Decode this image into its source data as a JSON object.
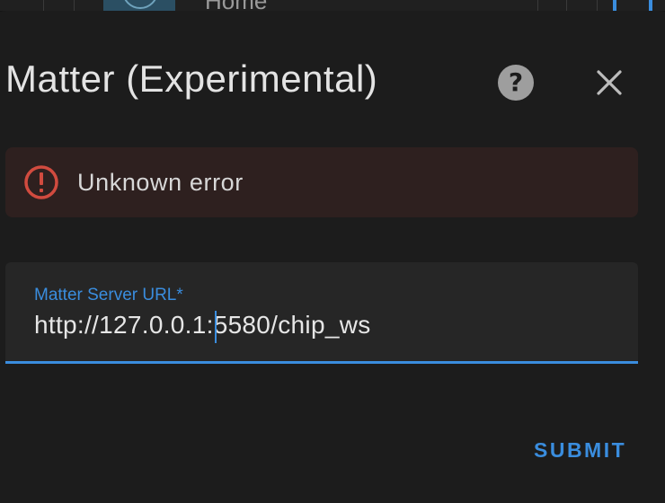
{
  "background": {
    "partial_title": "Home"
  },
  "dialog": {
    "title": "Matter (Experimental)",
    "help_icon": "help-circle-icon",
    "close_icon": "close-icon"
  },
  "alert": {
    "icon": "alert-circle-outline-icon",
    "message": "Unknown error",
    "color": "#d14b3f"
  },
  "form": {
    "url_label": "Matter Server URL*",
    "url_value": "http://127.0.0.1:5580/chip_ws"
  },
  "actions": {
    "submit_label": "SUBMIT"
  },
  "colors": {
    "accent": "#3a8dde",
    "surface": "#1c1c1c",
    "error_bg": "#2e201f"
  }
}
